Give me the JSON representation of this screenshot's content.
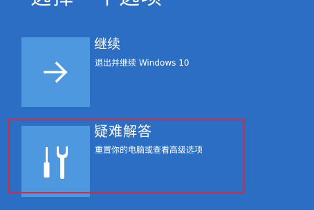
{
  "page": {
    "title": "选择一个选项",
    "background_color": "#2b6ec3",
    "tile_color": "#4e98e0",
    "highlight_color": "#d8293d"
  },
  "options": [
    {
      "id": "continue",
      "title": "继续",
      "description": "退出并继续 Windows 10",
      "icon": "arrow-right-icon"
    },
    {
      "id": "troubleshoot",
      "title": "疑难解答",
      "description": "重置你的电脑或查看高级选项",
      "icon": "tools-icon",
      "highlighted": true
    }
  ]
}
